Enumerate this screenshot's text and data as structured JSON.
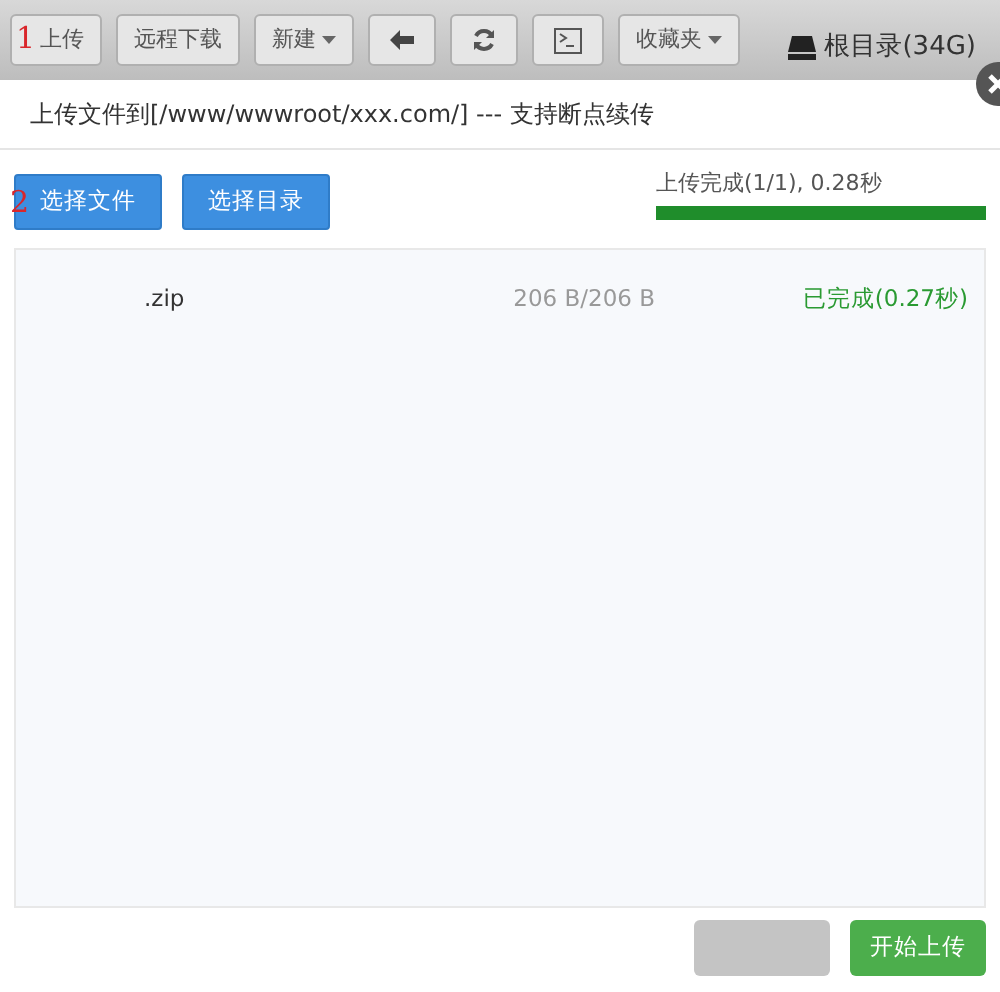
{
  "toolbar": {
    "annotation": "1",
    "buttons": [
      {
        "kind": "text",
        "label": "上传"
      },
      {
        "kind": "text",
        "label": "远程下载"
      },
      {
        "kind": "dropdown",
        "label": "新建"
      },
      {
        "kind": "back"
      },
      {
        "kind": "refresh"
      },
      {
        "kind": "terminal"
      },
      {
        "kind": "dropdown",
        "label": "收藏夹"
      }
    ],
    "disk": "根目录(34G)"
  },
  "dialog": {
    "title": "上传文件到[/www/wwwroot/xxx.com/] --- 支持断点续传",
    "annotation": "2",
    "buttons": [
      "选择文件",
      "选择目录"
    ],
    "progress": {
      "label": "上传完成(1/1), 0.28秒",
      "level": 1
    },
    "files": [
      {
        "name": ".zip",
        "size": "206 B/206 B",
        "status": "已完成(0.27秒)"
      }
    ],
    "footer": [
      {
        "kind": "secondary"
      },
      {
        "kind": "primary",
        "label": "开始上传"
      }
    ]
  }
}
